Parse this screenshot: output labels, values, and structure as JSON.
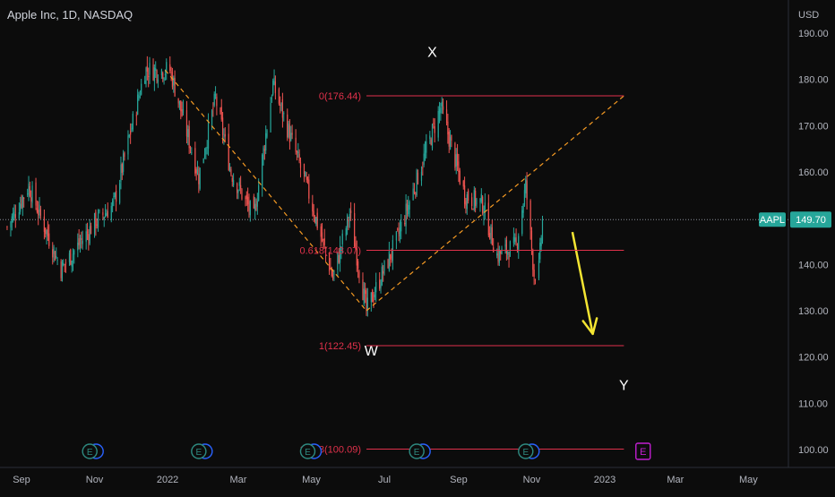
{
  "header": {
    "title": "Apple Inc, 1D, NASDAQ"
  },
  "price_axis": {
    "currency": "USD",
    "ticks": [
      "190.00",
      "180.00",
      "170.00",
      "160.00",
      "150.00",
      "140.00",
      "130.00",
      "120.00",
      "110.00",
      "100.00"
    ]
  },
  "time_axis": {
    "ticks": [
      "Sep",
      "Nov",
      "2022",
      "Mar",
      "May",
      "Jul",
      "Sep",
      "Nov",
      "2023",
      "Mar",
      "May"
    ]
  },
  "last_price": {
    "symbol": "AAPL",
    "value": "149.70"
  },
  "fib_levels": [
    {
      "label": "0(176.44)",
      "value": 176.44
    },
    {
      "label": "0.618(143.07)",
      "value": 143.07
    },
    {
      "label": "1(122.45)",
      "value": 122.45
    },
    {
      "label": "1.618(100.09)",
      "value": 100.09
    }
  ],
  "wave_labels": [
    "X",
    "W",
    "Y"
  ],
  "earnings_markers": [
    {
      "label": "E"
    },
    {
      "label": "E"
    },
    {
      "label": "E"
    },
    {
      "label": "E"
    },
    {
      "label": "E"
    },
    {
      "label": "E",
      "status": "upcoming"
    }
  ],
  "colors": {
    "background": "#0c0c0c",
    "candle_up": "#26a69a",
    "candle_down": "#ef5350",
    "fib_line": "#e0314b",
    "dashed_projection": "#f59a23",
    "arrow": "#f4e532",
    "price_badge": "#26a69a",
    "text": "#b2b5be"
  },
  "chart_data": {
    "type": "candlestick",
    "title": "Apple Inc, 1D, NASDAQ",
    "ylabel": "USD",
    "ylim": [
      98,
      194
    ],
    "last_close": 149.7,
    "x_range": [
      "2021-08-20",
      "2023-05-31"
    ],
    "price_path": [
      {
        "date": "2021-08-20",
        "close": 148
      },
      {
        "date": "2021-09-07",
        "close": 157
      },
      {
        "date": "2021-10-04",
        "close": 139
      },
      {
        "date": "2021-11-01",
        "close": 149
      },
      {
        "date": "2021-11-17",
        "close": 153
      },
      {
        "date": "2021-12-13",
        "close": 182
      },
      {
        "date": "2022-01-03",
        "close": 182
      },
      {
        "date": "2022-01-27",
        "close": 159
      },
      {
        "date": "2022-02-10",
        "close": 176
      },
      {
        "date": "2022-02-23",
        "close": 160
      },
      {
        "date": "2022-03-14",
        "close": 150
      },
      {
        "date": "2022-03-30",
        "close": 179
      },
      {
        "date": "2022-04-27",
        "close": 157
      },
      {
        "date": "2022-05-19",
        "close": 137
      },
      {
        "date": "2022-06-02",
        "close": 151
      },
      {
        "date": "2022-06-16",
        "close": 130
      },
      {
        "date": "2022-07-11",
        "close": 145
      },
      {
        "date": "2022-08-17",
        "close": 174
      },
      {
        "date": "2022-09-06",
        "close": 155
      },
      {
        "date": "2022-09-21",
        "close": 153
      },
      {
        "date": "2022-10-03",
        "close": 142
      },
      {
        "date": "2022-10-19",
        "close": 144
      },
      {
        "date": "2022-10-27",
        "close": 157
      },
      {
        "date": "2022-11-03",
        "close": 138
      },
      {
        "date": "2022-11-07",
        "close": 139
      },
      {
        "date": "2022-11-10",
        "close": 149.7
      }
    ],
    "fibonacci": {
      "anchor_high": {
        "date": "2021-12-30",
        "price": 182
      },
      "anchor_low": {
        "date": "2022-06-16",
        "price": 130
      },
      "anchor_end": {
        "date": "2023-01-17",
        "price": 176.44
      },
      "levels": [
        {
          "ratio": 0,
          "price": 176.44
        },
        {
          "ratio": 0.618,
          "price": 143.07
        },
        {
          "ratio": 1,
          "price": 122.45
        },
        {
          "ratio": 1.618,
          "price": 100.09
        }
      ],
      "level_start_date": "2022-06-16",
      "level_end_date": "2023-01-17"
    },
    "annotations": [
      {
        "text": "X",
        "date": "2022-08-10",
        "price": 186
      },
      {
        "text": "W",
        "date": "2022-06-20",
        "price": 121.5
      },
      {
        "text": "Y",
        "date": "2023-01-17",
        "price": 114
      }
    ],
    "forecast_arrow": {
      "from": {
        "date": "2022-12-05",
        "price": 147
      },
      "to": {
        "date": "2022-12-22",
        "price": 125
      }
    },
    "earnings_dates": [
      "2021-10-28",
      "2022-01-27",
      "2022-04-28",
      "2022-07-28",
      "2022-10-27",
      "2023-02-02"
    ],
    "grid": false
  }
}
